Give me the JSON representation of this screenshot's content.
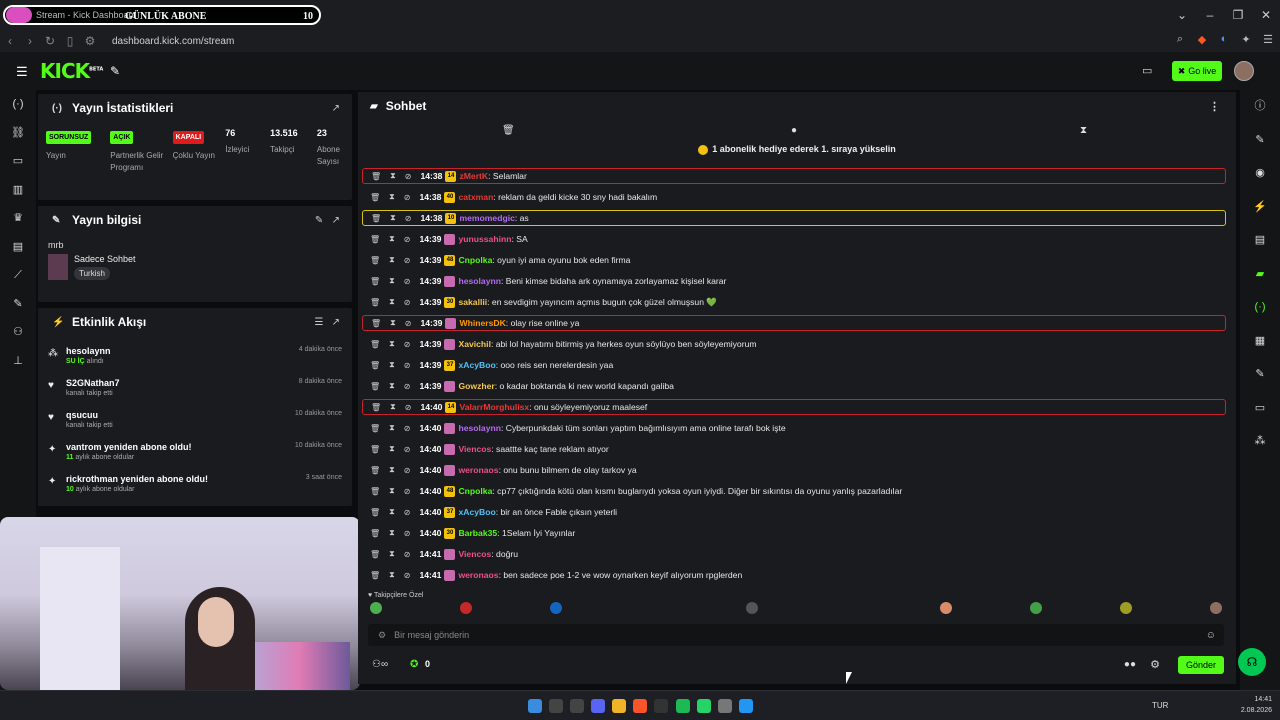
{
  "browser": {
    "tab_title": "Stream - Kick Dashboard",
    "overlay_goal_label": "GÜNLÜK ABONE",
    "overlay_goal_count": "10",
    "url": "dashboard.kick.com/stream"
  },
  "header": {
    "logo": "KICK",
    "logo_tag": "BETA",
    "go_live_label": "Go live"
  },
  "stats_panel": {
    "title": "Yayın İstatistikleri",
    "items": [
      {
        "badge": "SORUNSUZ",
        "label": "Yayın"
      },
      {
        "badge": "AÇIK",
        "label": "Partnerlik Gelir Programı"
      },
      {
        "badge": "KAPALI",
        "label": "Çoklu Yayın"
      },
      {
        "value": "76",
        "label": "İzleyici"
      },
      {
        "value": "13.516",
        "label": "Takipçi"
      },
      {
        "value": "23",
        "label": "Abone Sayısı"
      }
    ]
  },
  "info_panel": {
    "title": "Yayın bilgisi",
    "stream_title": "mrb",
    "category": "Sadece Sohbet",
    "tag": "Turkish"
  },
  "activity_panel": {
    "title": "Etkinlik Akışı",
    "events": [
      {
        "name": "hesolaynn",
        "highlight": "SU İÇ",
        "sub": "alındı",
        "time": "4 dakika önce"
      },
      {
        "name": "S2GNathan7",
        "highlight": "",
        "sub": "kanalı takip etti",
        "time": "8 dakika önce"
      },
      {
        "name": "qsucuu",
        "highlight": "",
        "sub": "kanalı takip etti",
        "time": "10 dakika önce"
      },
      {
        "name": "vantrom yeniden abone oldu!",
        "highlight": "11",
        "sub": "aylık abone oldular",
        "time": "10 dakika önce"
      },
      {
        "name": "rickrothman yeniden abone oldu!",
        "highlight": "10",
        "sub": "aylık abone oldular",
        "time": "3 saat önce"
      }
    ]
  },
  "chat": {
    "title": "Sohbet",
    "pinned": "1 abonelik hediye ederek 1. sıraya yükselin",
    "messages": [
      {
        "time": "14:38",
        "badge": "14",
        "user": "zMertK",
        "color": "#e53935",
        "text": ": Selamlar",
        "hl": "red"
      },
      {
        "time": "14:38",
        "badge": "40",
        "user": "catxman",
        "color": "#e53935",
        "text": ": reklam da geldi kicke 30 sny hadi bakalım",
        "hl": ""
      },
      {
        "time": "14:38",
        "badge": "10",
        "user": "memomedgic",
        "color": "#b46cf2",
        "text": ": as",
        "hl": "gold"
      },
      {
        "time": "14:39",
        "badge": "",
        "user": "yunussahinn",
        "color": "#ec4f8f",
        "text": ": SA",
        "hl": ""
      },
      {
        "time": "14:39",
        "badge": "48",
        "user": "Cnpolka",
        "color": "#53fc18",
        "text": ": oyun iyi ama oyunu bok eden firma",
        "hl": ""
      },
      {
        "time": "14:39",
        "badge": "",
        "user": "hesolaynn",
        "color": "#b46cf2",
        "text": ": Beni kimse bidaha ark oynamaya zorlayamaz kişisel karar",
        "hl": ""
      },
      {
        "time": "14:39",
        "badge": "30",
        "user": "sakallii",
        "color": "#f2c94c",
        "text": ": en sevdigim yayıncım açmıs bugun çok güzel olmuşsun 💚",
        "hl": ""
      },
      {
        "time": "14:39",
        "badge": "",
        "user": "WhinersDK",
        "color": "#ff9800",
        "text": ": olay rise online ya",
        "hl": "red"
      },
      {
        "time": "14:39",
        "badge": "",
        "user": "Xavichil",
        "color": "#f2c94c",
        "text": ": abi lol hayatımı bitirmiş ya herkes oyun söylüyo ben söyleyemiyorum",
        "hl": ""
      },
      {
        "time": "14:39",
        "badge": "37",
        "user": "xAcyBoo",
        "color": "#4fc3f7",
        "text": ": ooo reis sen nerelerdesin yaa",
        "hl": ""
      },
      {
        "time": "14:39",
        "badge": "",
        "user": "Gowzher",
        "color": "#f2c94c",
        "text": ": o kadar boktanda ki new world kapandı galiba",
        "hl": ""
      },
      {
        "time": "14:40",
        "badge": "14",
        "user": "ValarrMorghulisx",
        "color": "#e53935",
        "text": ": onu söyleyemiyoruz maalesef",
        "hl": "red"
      },
      {
        "time": "14:40",
        "badge": "",
        "user": "hesolaynn",
        "color": "#b46cf2",
        "text": ": Cyberpunkdaki tüm sonları yaptım bağımlısıyım ama online tarafı bok işte",
        "hl": ""
      },
      {
        "time": "14:40",
        "badge": "",
        "user": "Viencos",
        "color": "#ec4f8f",
        "text": ": saattte kaç tane reklam atıyor",
        "hl": ""
      },
      {
        "time": "14:40",
        "badge": "",
        "user": "weronaos",
        "color": "#ec4f8f",
        "text": ": onu bunu bilmem de olay tarkov ya",
        "hl": ""
      },
      {
        "time": "14:40",
        "badge": "48",
        "user": "Cnpolka",
        "color": "#53fc18",
        "text": ": cp77 çıktığında kötü olan kısmı buglarıydı yoksa oyun iyiydi. Diğer bir sıkıntısı da oyunu yanlış pazarladılar",
        "hl": ""
      },
      {
        "time": "14:40",
        "badge": "37",
        "user": "xAcyBoo",
        "color": "#4fc3f7",
        "text": ": bir an önce Fable çıksın yeterli",
        "hl": ""
      },
      {
        "time": "14:40",
        "badge": "30",
        "user": "Barbak35",
        "color": "#53fc18",
        "text": ": 1Selam İyi Yayınlar",
        "hl": ""
      },
      {
        "time": "14:41",
        "badge": "",
        "user": "Viencos",
        "color": "#ec4f8f",
        "text": ": doğru",
        "hl": ""
      },
      {
        "time": "14:41",
        "badge": "",
        "user": "weronaos",
        "color": "#ec4f8f",
        "text": ": ben sadece poe 1-2 ve wow oynarken keyif alıyorum rpglerden",
        "hl": ""
      }
    ],
    "emote_section_label": "Takipçilere Özel",
    "input_placeholder": "Bir mesaj gönderin",
    "points_count": "0",
    "send_label": "Gönder"
  },
  "taskbar": {
    "lang": "TUR",
    "time": "14:41",
    "date": "2.08.2026"
  },
  "colors": {
    "accent": "#53fc18",
    "danger": "#e01b1b",
    "highlight_gold": "#d7c312"
  }
}
